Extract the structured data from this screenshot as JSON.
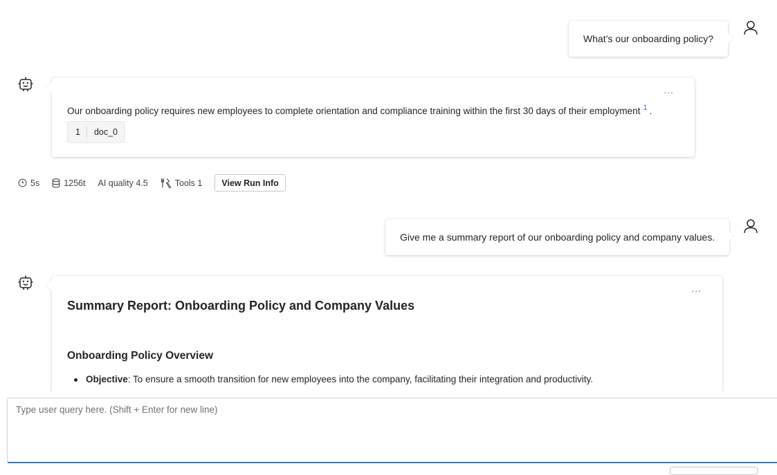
{
  "messages": [
    {
      "role": "user",
      "text": "What’s our onboarding policy?"
    },
    {
      "role": "assistant",
      "text": "Our onboarding policy requires new employees to complete orientation and compliance training within the first 30 days of their employment",
      "citation_ref": "1",
      "trailing": ".",
      "citations": [
        {
          "num": "1",
          "doc": "doc_0"
        }
      ],
      "more_label": "..."
    },
    {
      "role": "user",
      "text": "Give me a summary report of our onboarding policy and company values."
    },
    {
      "role": "assistant",
      "title": "Summary Report: Onboarding Policy and Company Values",
      "section": "Onboarding Policy Overview",
      "bullet_label": "Objective",
      "bullet_text": ": To ensure a smooth transition for new employees into the company, facilitating their integration and productivity.",
      "more_label": "..."
    }
  ],
  "run_stats": {
    "time": "5s",
    "tokens": "1256t",
    "quality": "AI quality 4.5",
    "tools": "Tools 1",
    "view_run_info": "View Run Info"
  },
  "input": {
    "placeholder": "Type user query here. (Shift + Enter for new line)",
    "value": ""
  },
  "colors": {
    "accent": "#2e7cc4",
    "link": "#3a7ec8"
  }
}
